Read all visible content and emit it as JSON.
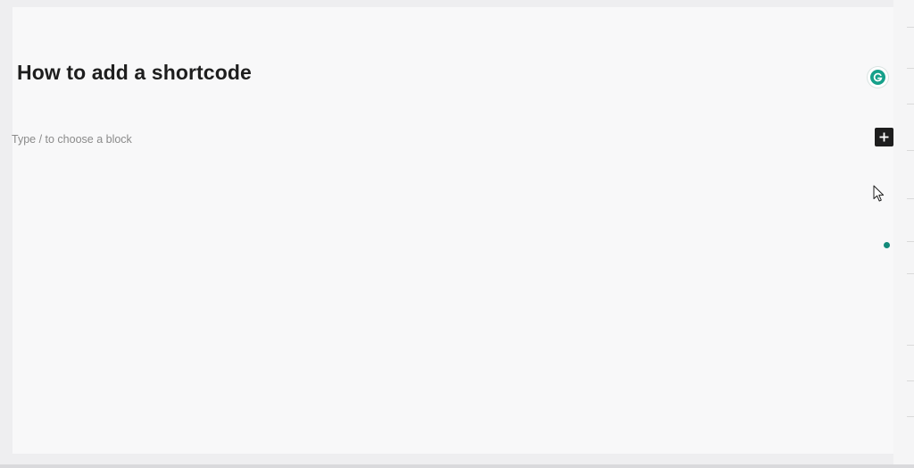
{
  "editor": {
    "post_title": "How to add a shortcode",
    "block_placeholder": "Type / to choose a block"
  },
  "icons": {
    "grammarly": "grammarly-icon",
    "add_block": "plus-icon",
    "cursor": "mouse-pointer-icon",
    "status_dot": "status-dot-icon"
  },
  "colors": {
    "canvas_bg": "#f8f8f9",
    "title_text": "#1e1e1e",
    "placeholder_text": "#8a8a8a",
    "inserter_bg": "#1e1e1e",
    "grammarly_green": "#15a08a"
  }
}
